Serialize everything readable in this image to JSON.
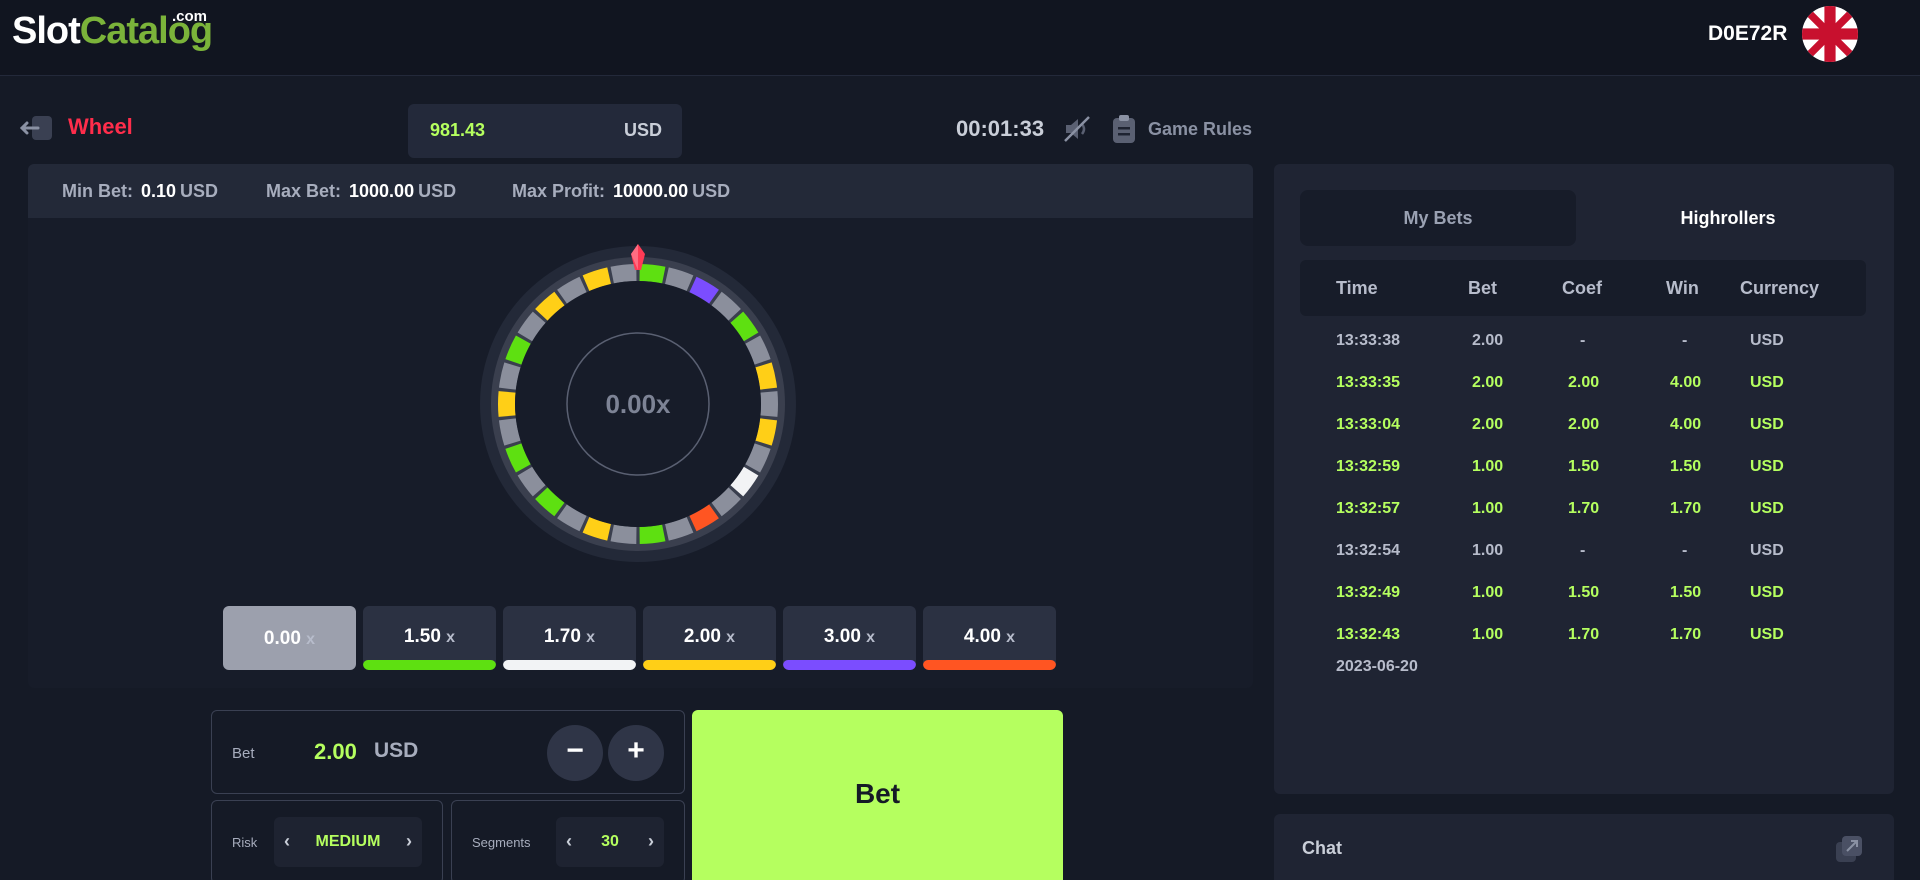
{
  "brand": {
    "logo_part1": "Slot",
    "logo_part2": "Catalog",
    "logo_suffix": ".com"
  },
  "header": {
    "user_id": "D0E72R",
    "language_flag": "uk-flag-icon"
  },
  "game": {
    "name": "Wheel",
    "balance": "981.43",
    "balance_currency": "USD",
    "timer": "00:01:33",
    "rules_label": "Game Rules"
  },
  "limits": {
    "min_bet_label": "Min Bet:",
    "min_bet_value": "0.10",
    "min_bet_currency": "USD",
    "max_bet_label": "Max Bet:",
    "max_bet_value": "1000.00",
    "max_bet_currency": "USD",
    "max_profit_label": "Max Profit:",
    "max_profit_value": "10000.00",
    "max_profit_currency": "USD"
  },
  "wheel": {
    "center_value": "0.00x",
    "segments": [
      "green",
      "gray",
      "purple",
      "gray",
      "green",
      "gray",
      "yellow",
      "gray",
      "yellow",
      "gray",
      "white",
      "gray",
      "orange",
      "gray",
      "green",
      "gray",
      "yellow",
      "gray",
      "green",
      "gray",
      "green",
      "gray",
      "yellow",
      "gray",
      "green",
      "gray",
      "yellow",
      "gray",
      "yellow",
      "gray"
    ]
  },
  "multipliers": [
    {
      "value": "0.00",
      "suffix": "x",
      "color": "",
      "selected": true
    },
    {
      "value": "1.50",
      "suffix": "x",
      "color": "#5ee011"
    },
    {
      "value": "1.70",
      "suffix": "x",
      "color": "#f2f3f5"
    },
    {
      "value": "2.00",
      "suffix": "x",
      "color": "#ffcf17"
    },
    {
      "value": "3.00",
      "suffix": "x",
      "color": "#7b4dff"
    },
    {
      "value": "4.00",
      "suffix": "x",
      "color": "#ff5522"
    }
  ],
  "segment_colors": {
    "green": "#5ee011",
    "gray": "#8b8f9c",
    "purple": "#7b4dff",
    "yellow": "#ffcf17",
    "white": "#f2f3f5",
    "orange": "#ff5522"
  },
  "controls": {
    "bet_label": "Bet",
    "bet_value": "2.00",
    "bet_currency": "USD",
    "minus_label": "−",
    "plus_label": "+",
    "risk_label": "Risk",
    "risk_value": "MEDIUM",
    "segments_label": "Segments",
    "segments_value": "30",
    "prev_glyph": "‹",
    "next_glyph": "›",
    "bet_button_label": "Bet"
  },
  "bets": {
    "tabs": [
      "My Bets",
      "Highrollers"
    ],
    "columns": [
      "Time",
      "Bet",
      "Coef",
      "Win",
      "Currency"
    ],
    "rows": [
      {
        "time": "13:33:38",
        "bet": "2.00",
        "coef": "-",
        "win": "-",
        "currency": "USD",
        "won": false
      },
      {
        "time": "13:33:35",
        "bet": "2.00",
        "coef": "2.00",
        "win": "4.00",
        "currency": "USD",
        "won": true
      },
      {
        "time": "13:33:04",
        "bet": "2.00",
        "coef": "2.00",
        "win": "4.00",
        "currency": "USD",
        "won": true
      },
      {
        "time": "13:32:59",
        "bet": "1.00",
        "coef": "1.50",
        "win": "1.50",
        "currency": "USD",
        "won": true
      },
      {
        "time": "13:32:57",
        "bet": "1.00",
        "coef": "1.70",
        "win": "1.70",
        "currency": "USD",
        "won": true
      },
      {
        "time": "13:32:54",
        "bet": "1.00",
        "coef": "-",
        "win": "-",
        "currency": "USD",
        "won": false
      },
      {
        "time": "13:32:49",
        "bet": "1.00",
        "coef": "1.50",
        "win": "1.50",
        "currency": "USD",
        "won": true
      },
      {
        "time": "13:32:43",
        "bet": "1.00",
        "coef": "1.70",
        "win": "1.70",
        "currency": "USD",
        "won": true
      }
    ],
    "date": "2023-06-20"
  },
  "chat": {
    "title": "Chat"
  }
}
